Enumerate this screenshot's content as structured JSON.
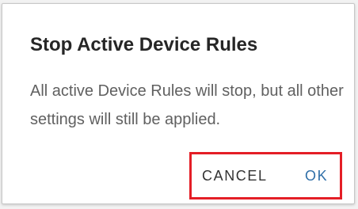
{
  "dialog": {
    "title": "Stop Active Device Rules",
    "message": "All active Device Rules will stop, but all other settings will still be applied.",
    "cancel_label": "CANCEL",
    "ok_label": "OK"
  },
  "colors": {
    "highlight_border": "#e41e26",
    "ok_accent": "#2f6fa8",
    "title_text": "#262626",
    "body_text": "#606060"
  }
}
